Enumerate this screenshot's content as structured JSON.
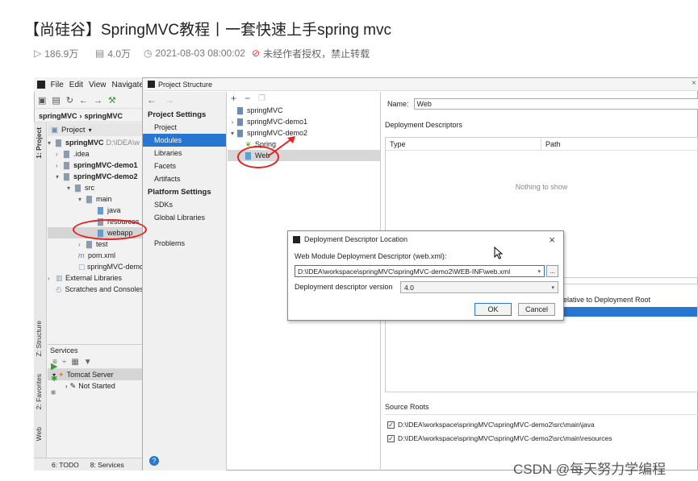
{
  "video": {
    "title": "【尚硅谷】SpringMVC教程丨一套快速上手spring mvc",
    "views": "186.9万",
    "danmaku": "4.0万",
    "date": "2021-08-03 08:00:02",
    "no_repost": "未经作者授权，禁止转载"
  },
  "ide": {
    "menu": [
      "File",
      "Edit",
      "View",
      "Navigate"
    ],
    "breadcrumb": [
      "springMVC",
      "springMVC"
    ],
    "project_label": "Project",
    "side_tabs": [
      "1: Project",
      "Z: Structure",
      "2: Favorites",
      "Web"
    ],
    "tree": [
      {
        "label": "springMVC",
        "extra": "D:\\IDEA\\w",
        "bold": true
      },
      {
        "label": ".idea"
      },
      {
        "label": "springMVC-demo1",
        "bold": true
      },
      {
        "label": "springMVC-demo2",
        "bold": true
      },
      {
        "label": "src"
      },
      {
        "label": "main"
      },
      {
        "label": "java"
      },
      {
        "label": "resources"
      },
      {
        "label": "webapp"
      },
      {
        "label": "test"
      },
      {
        "label": "pom.xml"
      },
      {
        "label": "springMVC-demo"
      },
      {
        "label": "External Libraries"
      },
      {
        "label": "Scratches and Consoles"
      }
    ],
    "services_label": "Services",
    "services": [
      {
        "label": "Tomcat Server"
      },
      {
        "label": "Not Started"
      }
    ],
    "bottom_tabs": [
      "6: TODO",
      "8: Services"
    ]
  },
  "project_structure": {
    "title": "Project Structure",
    "project_settings_label": "Project Settings",
    "project_settings": [
      "Project",
      "Modules",
      "Libraries",
      "Facets",
      "Artifacts"
    ],
    "platform_settings_label": "Platform Settings",
    "platform_settings": [
      "SDKs",
      "Global Libraries"
    ],
    "problems": "Problems",
    "modules": [
      {
        "label": "springMVC"
      },
      {
        "label": "springMVC-demo1"
      },
      {
        "label": "springMVC-demo2"
      },
      {
        "label": "Spring"
      },
      {
        "label": "Web"
      }
    ],
    "name_label": "Name:",
    "name_value": "Web",
    "deployment_descriptors": "Deployment Descriptors",
    "col_type": "Type",
    "col_path": "Path",
    "empty": "Nothing to show",
    "web_root_col": "elative to Deployment Root",
    "source_roots": "Source Roots",
    "source_paths": [
      "D:\\IDEA\\workspace\\springMVC\\springMVC-demo2\\src\\main\\java",
      "D:\\IDEA\\workspace\\springMVC\\springMVC-demo2\\src\\main\\resources"
    ]
  },
  "dialog": {
    "title": "Deployment Descriptor Location",
    "path_label": "Web Module Deployment Descriptor (web.xml):",
    "path_value": "D:\\IDEA\\workspace\\springMVC\\springMVC-demo2\\WEB-INF\\web.xml",
    "browse": "...",
    "version_label": "Deployment descriptor version",
    "version_value": "4.0",
    "ok": "OK",
    "cancel": "Cancel"
  },
  "watermark": "CSDN @每天努力学编程",
  "colors": {
    "selection": "#2676d2",
    "annotation": "#e52222"
  }
}
